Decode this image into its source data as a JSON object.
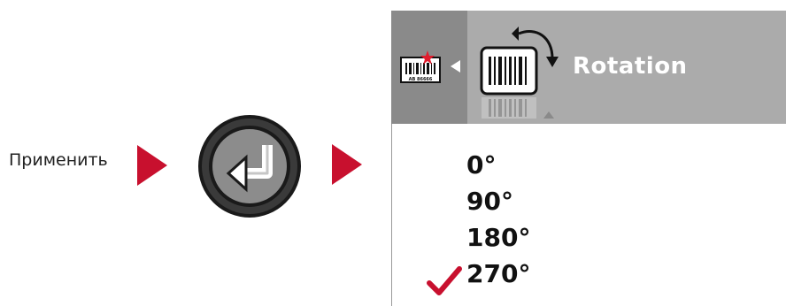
{
  "instruction": {
    "apply_label": "Применить"
  },
  "screen": {
    "title": "Rotation",
    "label_icon_text": "AB 86666",
    "options": [
      {
        "label": "0°"
      },
      {
        "label": "90°"
      },
      {
        "label": "180°"
      },
      {
        "label": "270°"
      }
    ],
    "selected_index": 3
  },
  "colors": {
    "accent": "#c8102e",
    "header_bg": "#ababab",
    "header_dark": "#8a8a8a",
    "header_text": "#ffffff"
  },
  "icons": [
    "arrow-right-icon",
    "enter-key-icon",
    "label-icon",
    "back-arrow-icon",
    "barcode-rotation-icon",
    "checkmark-icon"
  ]
}
